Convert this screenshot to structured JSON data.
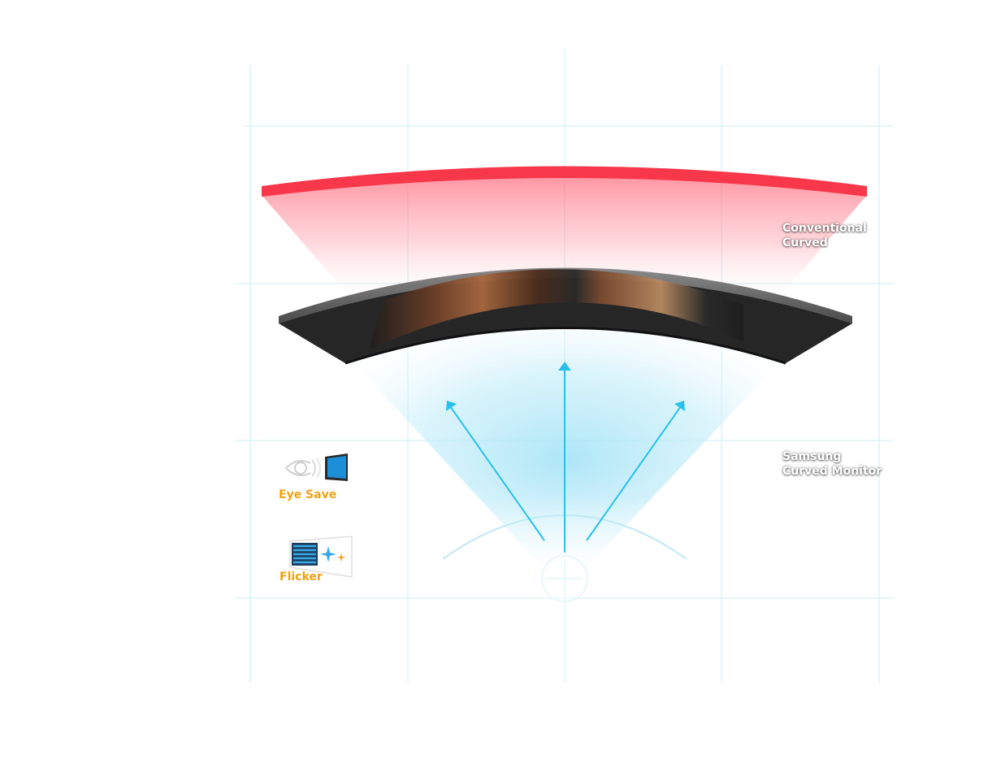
{
  "labels": {
    "conventional_line1": "Conventional",
    "conventional_line2": "Curved",
    "samsung_line1": "Samsung",
    "samsung_line2": "Curved Monitor"
  },
  "features": [
    {
      "label": "Eye Save",
      "icon": "eye-monitor-icon"
    },
    {
      "label": "Flicker",
      "icon": "flicker-free-icon"
    }
  ],
  "colors": {
    "conventional_curve": "#f8374a",
    "samsung_field": "#a6e4f6",
    "arrow": "#27c1ec",
    "grid": "#cdeff6",
    "feature_label": "#f2a10f",
    "bezel": "#3b3b3b"
  }
}
